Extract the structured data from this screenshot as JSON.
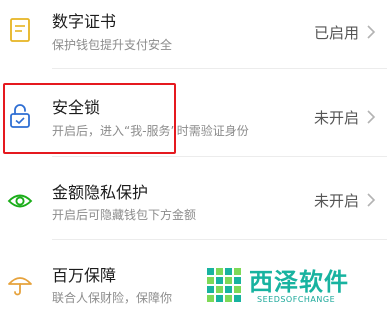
{
  "items": [
    {
      "title": "数字证书",
      "subtitle": "保护钱包提升支付安全",
      "status": "已启用",
      "icon": "certificate-icon"
    },
    {
      "title": "安全锁",
      "subtitle": "开启后，进入“我-服务”时需验证身份",
      "status": "未开启",
      "icon": "lock-icon"
    },
    {
      "title": "金额隐私保护",
      "subtitle": "开启后可隐藏钱包下方金额",
      "status": "未开启",
      "icon": "eye-icon"
    },
    {
      "title": "百万保障",
      "subtitle": "联合人保财险，保障你",
      "status": "",
      "icon": "umbrella-icon"
    }
  ],
  "watermark": {
    "name": "西泽软件",
    "tagline": "SEEDSOFCHANGE"
  },
  "colors": {
    "accent": "#1aad19",
    "highlight_border": "#e5191f",
    "watermark": "#18b3a0"
  }
}
